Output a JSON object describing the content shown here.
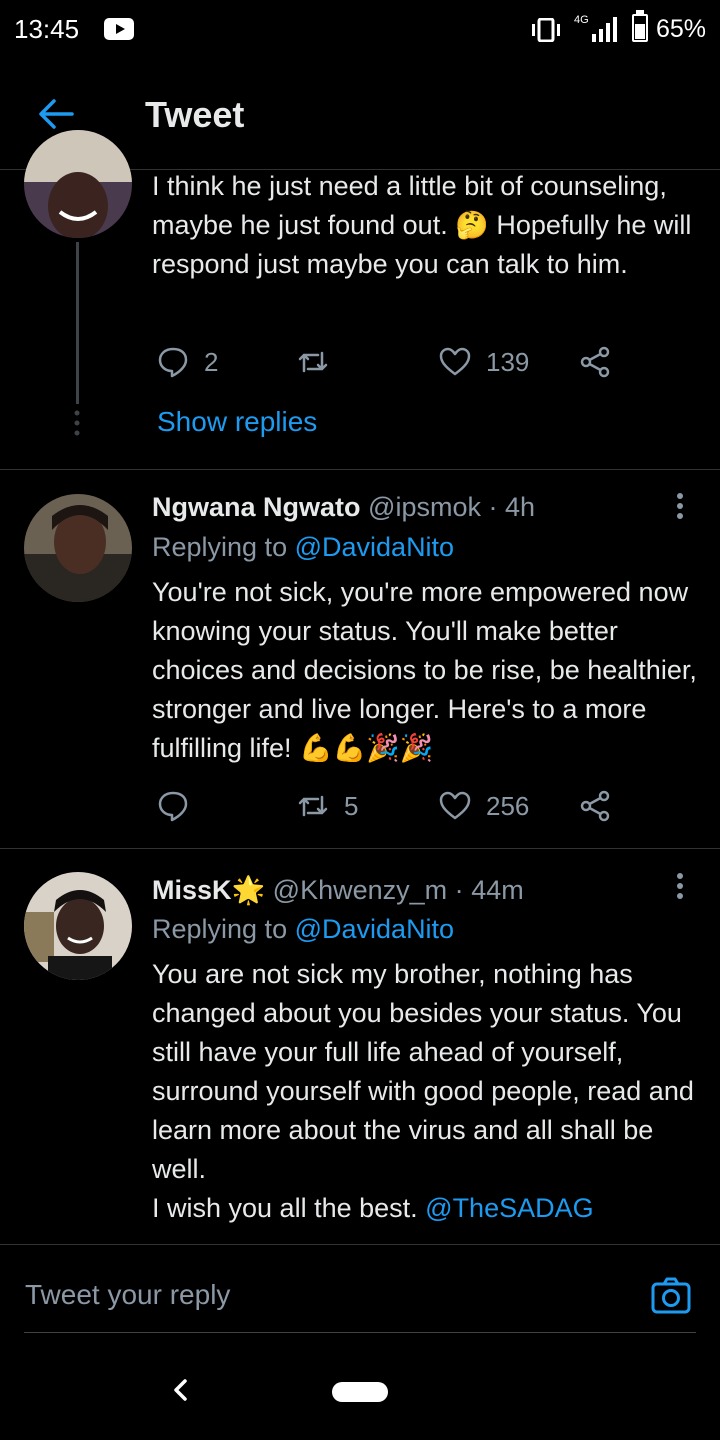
{
  "status_bar": {
    "time": "13:45",
    "network": "4G",
    "battery": "65%"
  },
  "header": {
    "title": "Tweet"
  },
  "tweets": [
    {
      "text": "I think he just need a little bit of counseling, maybe he just found out. 🤔 Hopefully he will respond just maybe you can talk to him.",
      "replies": "2",
      "likes": "139",
      "show_replies": "Show replies"
    },
    {
      "display_name": "Ngwana Ngwato",
      "handle": "@ipsmok",
      "time": "4h",
      "replying_prefix": "Replying to",
      "replying_to": "@DavidaNito",
      "text": "You're not sick, you're more empowered now knowing your status. You'll make better choices and decisions to be rise, be healthier, stronger and live longer. Here's to a more fulfilling life! 💪💪🎉🎉",
      "retweets": "5",
      "likes": "256"
    },
    {
      "display_name": "MissK🌟",
      "handle": "@Khwenzy_m",
      "time": "44m",
      "replying_prefix": "Replying to",
      "replying_to": "@DavidaNito",
      "text": "You are not sick my brother, nothing has changed about you besides your status. You still have your full life ahead of yourself, surround yourself with good people, read and learn more about the virus and all shall be well.",
      "text_line2": "I wish you all the best.",
      "mention": "@TheSADAG"
    }
  ],
  "reply_bar": {
    "placeholder": "Tweet your reply"
  },
  "colors": {
    "accent": "#1d9bf0",
    "background": "#000000",
    "secondary_text": "#8b98a5"
  }
}
